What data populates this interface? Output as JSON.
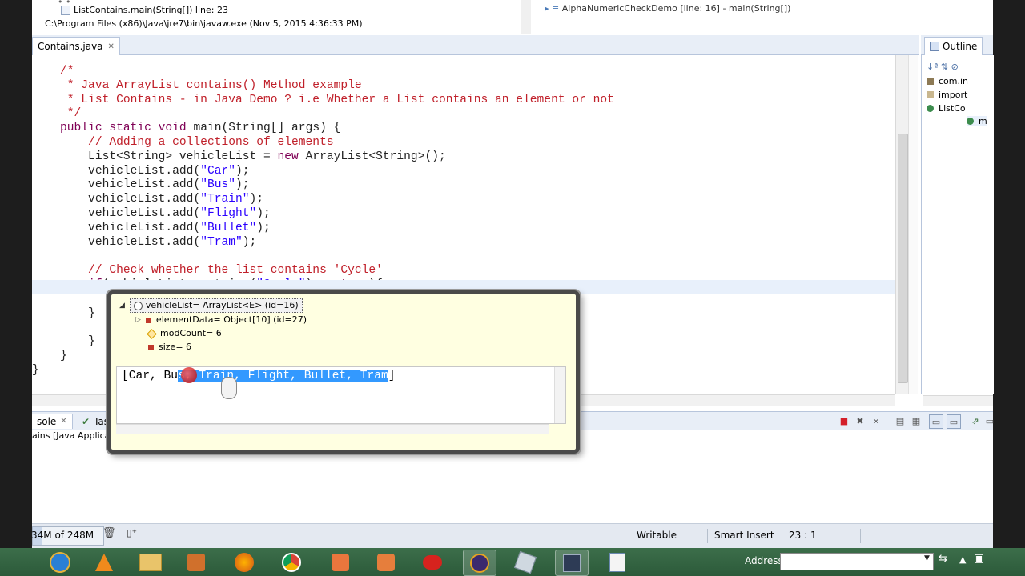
{
  "debug": {
    "stack_frame": "ListContains.main(String[]) line: 23",
    "process": "C:\\Program Files (x86)\\Java\\jre7\\bin\\javaw.exe (Nov 5, 2015 4:36:33 PM)",
    "right_frame": "AlphaNumericCheckDemo [line: 16] - main(String[])"
  },
  "editor": {
    "tab_label": "Contains.java",
    "tab_close": "✕",
    "code_lines": [
      {
        "text": "    /*",
        "kind": "comment"
      },
      {
        "text": "     * Java ArrayList contains() Method example",
        "kind": "comment"
      },
      {
        "text": "     * List Contains - in Java Demo ? i.e Whether a List contains an element or not",
        "kind": "comment"
      },
      {
        "text": "     */",
        "kind": "comment"
      },
      {
        "text": "    public static void main(String[] args) {",
        "kind": "plain"
      },
      {
        "text": "        // Adding a collections of elements",
        "kind": "comment"
      },
      {
        "text": "        List<String> vehicleList = new ArrayList<String>();",
        "kind": "plain"
      },
      {
        "text": "        vehicleList.add(\"Car\");",
        "kind": "plain"
      },
      {
        "text": "        vehicleList.add(\"Bus\");",
        "kind": "plain"
      },
      {
        "text": "        vehicleList.add(\"Train\");",
        "kind": "plain"
      },
      {
        "text": "        vehicleList.add(\"Flight\");",
        "kind": "plain"
      },
      {
        "text": "        vehicleList.add(\"Bullet\");",
        "kind": "plain"
      },
      {
        "text": "        vehicleList.add(\"Tram\");",
        "kind": "plain"
      },
      {
        "text": "",
        "kind": "plain"
      },
      {
        "text": "        // Check whether the list contains 'Cycle'",
        "kind": "comment"
      },
      {
        "text": "        if(vehicleList.contains(\"Cycle\") == true){",
        "kind": "plain"
      },
      {
        "text": "",
        "kind": "plain"
      },
      {
        "text": "        }",
        "kind": "plain"
      },
      {
        "text": "",
        "kind": "plain"
      },
      {
        "text": "        }",
        "kind": "plain"
      },
      {
        "text": "    }",
        "kind": "plain"
      },
      {
        "text": "}",
        "kind": "plain"
      }
    ]
  },
  "outline": {
    "tab_label": "Outline",
    "items": [
      "com.in",
      "import",
      "ListCo",
      "m"
    ]
  },
  "popup": {
    "root": "vehicleList= ArrayList<E>  (id=16)",
    "children": [
      "elementData= Object[10]  (id=27)",
      "modCount= 6",
      "size= 6"
    ],
    "detail_prefix": "[Car, Bu",
    "detail_selected": "s, Train, Flight, Bullet, Tram",
    "detail_suffix": "]"
  },
  "console": {
    "tab_label": "sole",
    "second_tab": "Tas",
    "description": "ains [Java Application] C:\\Program Files (x86)\\Java\\jre7\\bin\\javaw.exe (Nov 5, 2015 4:36:33 PM)"
  },
  "status": {
    "heap": "34M of 248M",
    "writable": "Writable",
    "insert_mode": "Smart Insert",
    "position": "23 : 1"
  },
  "taskbar": {
    "address_label": "Address"
  },
  "colors": {
    "comment": "#c0202a",
    "string": "#2a00ff",
    "keyword": "#7f0055",
    "selection": "#3399ff",
    "popup_bg": "#ffffe1"
  }
}
